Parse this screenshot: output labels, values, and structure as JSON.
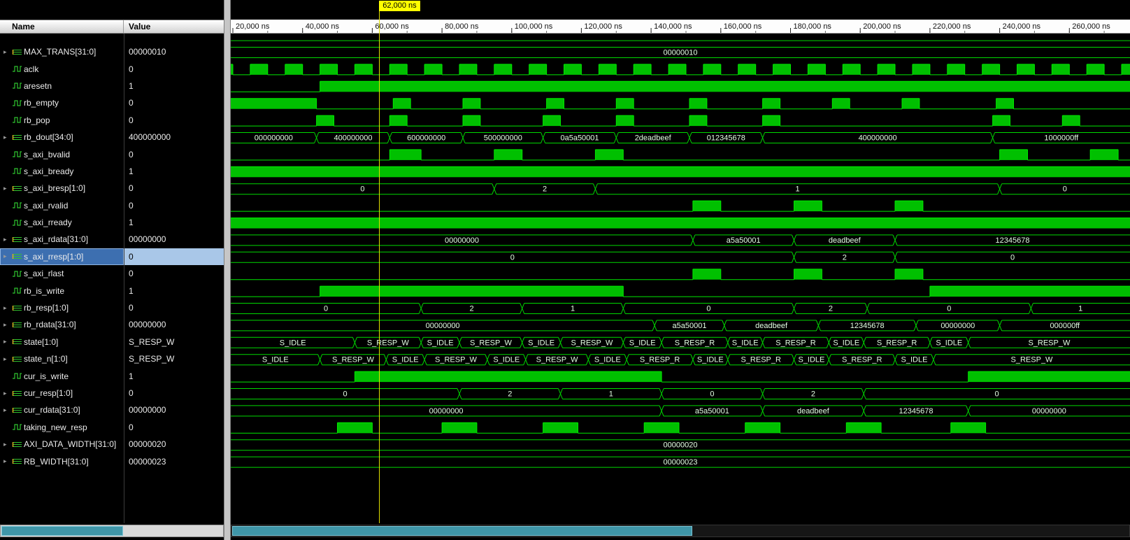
{
  "header": {
    "name_col": "Name",
    "value_col": "Value"
  },
  "cursor": {
    "time_ns": 62000,
    "label": "62,000 ns"
  },
  "icons": {
    "expander_glyph": "▸"
  },
  "colors": {
    "wave_fill": "#00c000",
    "wave_stroke": "#00e800",
    "bus_stroke": "#00d800",
    "bus_text": "#e4ffe4",
    "cursor_line": "#dede00",
    "cursor_flag_bg": "#ffff00",
    "selected_name_bg": "#3d6fb0",
    "selected_value_bg": "#a9c7e8",
    "scrollbar_thumb": "#3f96a8",
    "ruler_bg": "#fdfdfd"
  },
  "timeline": {
    "t_min": 19400,
    "t_max": 277400,
    "unit": "ns",
    "minor_step": 10000,
    "major_ticks": [
      {
        "t": 20000,
        "label": "20,000 ns"
      },
      {
        "t": 40000,
        "label": "40,000 ns"
      },
      {
        "t": 60000,
        "label": "60,000 ns"
      },
      {
        "t": 80000,
        "label": "80,000 ns"
      },
      {
        "t": 100000,
        "label": "100,000 ns"
      },
      {
        "t": 120000,
        "label": "120,000 ns"
      },
      {
        "t": 140000,
        "label": "140,000 ns"
      },
      {
        "t": 160000,
        "label": "160,000 ns"
      },
      {
        "t": 180000,
        "label": "180,000 ns"
      },
      {
        "t": 200000,
        "label": "200,000 ns"
      },
      {
        "t": 220000,
        "label": "220,000 ns"
      },
      {
        "t": 240000,
        "label": "240,000 ns"
      },
      {
        "t": 260000,
        "label": "260,000 ns"
      }
    ]
  },
  "signals": [
    {
      "partial": true,
      "name": "",
      "value": "",
      "kind": "bus",
      "icon": "bus",
      "expandable": false,
      "segments": [
        [
          19400,
          277400,
          ""
        ]
      ]
    },
    {
      "name": "MAX_TRANS[31:0]",
      "value": "00000010",
      "kind": "bus",
      "icon": "bus",
      "expandable": true,
      "segments": [
        [
          19400,
          277400,
          "00000010"
        ]
      ]
    },
    {
      "name": "aclk",
      "value": "0",
      "kind": "clock",
      "icon": "bit",
      "expandable": false,
      "period": 10000,
      "first_rise": 15000
    },
    {
      "name": "aresetn",
      "value": "1",
      "kind": "bit",
      "icon": "bit",
      "expandable": false,
      "segments": [
        [
          19400,
          45000,
          0
        ],
        [
          45000,
          277400,
          1
        ]
      ]
    },
    {
      "name": "rb_empty",
      "value": "0",
      "kind": "bit",
      "icon": "bit",
      "expandable": false,
      "segments": [
        [
          19400,
          44000,
          1
        ],
        [
          44000,
          66000,
          0
        ],
        [
          66000,
          71000,
          1
        ],
        [
          71000,
          86000,
          0
        ],
        [
          86000,
          91000,
          1
        ],
        [
          91000,
          110000,
          0
        ],
        [
          110000,
          115000,
          1
        ],
        [
          115000,
          130000,
          0
        ],
        [
          130000,
          135000,
          1
        ],
        [
          135000,
          151000,
          0
        ],
        [
          151000,
          156000,
          1
        ],
        [
          156000,
          172000,
          0
        ],
        [
          172000,
          177000,
          1
        ],
        [
          177000,
          192000,
          0
        ],
        [
          192000,
          197000,
          1
        ],
        [
          197000,
          212000,
          0
        ],
        [
          212000,
          217000,
          1
        ],
        [
          217000,
          239000,
          0
        ],
        [
          239000,
          244000,
          1
        ],
        [
          244000,
          277400,
          0
        ]
      ]
    },
    {
      "name": "rb_pop",
      "value": "0",
      "kind": "bit",
      "icon": "bit",
      "expandable": false,
      "segments": [
        [
          19400,
          44000,
          0
        ],
        [
          44000,
          49000,
          1
        ],
        [
          49000,
          65000,
          0
        ],
        [
          65000,
          70000,
          1
        ],
        [
          70000,
          86000,
          0
        ],
        [
          86000,
          91000,
          1
        ],
        [
          91000,
          109000,
          0
        ],
        [
          109000,
          114000,
          1
        ],
        [
          114000,
          130000,
          0
        ],
        [
          130000,
          135000,
          1
        ],
        [
          135000,
          151000,
          0
        ],
        [
          151000,
          156000,
          1
        ],
        [
          156000,
          172000,
          0
        ],
        [
          172000,
          177000,
          1
        ],
        [
          177000,
          238000,
          0
        ],
        [
          238000,
          243000,
          1
        ],
        [
          243000,
          258000,
          0
        ],
        [
          258000,
          263000,
          1
        ],
        [
          263000,
          277400,
          0
        ]
      ]
    },
    {
      "name": "rb_dout[34:0]",
      "value": "400000000",
      "kind": "bus",
      "icon": "bus",
      "expandable": true,
      "segments": [
        [
          19400,
          44000,
          "000000000"
        ],
        [
          44000,
          65000,
          "400000000"
        ],
        [
          65000,
          86000,
          "600000000"
        ],
        [
          86000,
          109000,
          "500000000"
        ],
        [
          109000,
          130000,
          "0a5a50001"
        ],
        [
          130000,
          151000,
          "2deadbeef"
        ],
        [
          151000,
          172000,
          "012345678"
        ],
        [
          172000,
          238000,
          "400000000"
        ],
        [
          238000,
          277400,
          "1000000ff"
        ]
      ]
    },
    {
      "name": "s_axi_bvalid",
      "value": "0",
      "kind": "bit",
      "icon": "bit",
      "expandable": false,
      "segments": [
        [
          19400,
          65000,
          0
        ],
        [
          65000,
          74000,
          1
        ],
        [
          74000,
          95000,
          0
        ],
        [
          95000,
          103000,
          1
        ],
        [
          103000,
          124000,
          0
        ],
        [
          124000,
          132000,
          1
        ],
        [
          132000,
          240000,
          0
        ],
        [
          240000,
          248000,
          1
        ],
        [
          248000,
          266000,
          0
        ],
        [
          266000,
          274000,
          1
        ],
        [
          274000,
          277400,
          0
        ]
      ]
    },
    {
      "name": "s_axi_bready",
      "value": "1",
      "kind": "bit",
      "icon": "bit",
      "expandable": false,
      "segments": [
        [
          19400,
          277400,
          1
        ]
      ]
    },
    {
      "name": "s_axi_bresp[1:0]",
      "value": "0",
      "kind": "bus",
      "icon": "bus",
      "expandable": true,
      "segments": [
        [
          19400,
          95000,
          "0"
        ],
        [
          95000,
          124000,
          "2"
        ],
        [
          124000,
          240000,
          "1"
        ],
        [
          240000,
          277400,
          "0"
        ]
      ]
    },
    {
      "name": "s_axi_rvalid",
      "value": "0",
      "kind": "bit",
      "icon": "bit",
      "expandable": false,
      "segments": [
        [
          19400,
          152000,
          0
        ],
        [
          152000,
          160000,
          1
        ],
        [
          160000,
          181000,
          0
        ],
        [
          181000,
          189000,
          1
        ],
        [
          189000,
          210000,
          0
        ],
        [
          210000,
          218000,
          1
        ],
        [
          218000,
          277400,
          0
        ]
      ]
    },
    {
      "name": "s_axi_rready",
      "value": "1",
      "kind": "bit",
      "icon": "bit",
      "expandable": false,
      "segments": [
        [
          19400,
          277400,
          1
        ]
      ]
    },
    {
      "name": "s_axi_rdata[31:0]",
      "value": "00000000",
      "kind": "bus",
      "icon": "bus",
      "expandable": true,
      "segments": [
        [
          19400,
          152000,
          "00000000"
        ],
        [
          152000,
          181000,
          "a5a50001"
        ],
        [
          181000,
          210000,
          "deadbeef"
        ],
        [
          210000,
          277400,
          "12345678"
        ]
      ]
    },
    {
      "name": "s_axi_rresp[1:0]",
      "value": "0",
      "kind": "bus",
      "icon": "bus",
      "expandable": true,
      "selected": true,
      "segments": [
        [
          19400,
          181000,
          "0"
        ],
        [
          181000,
          210000,
          "2"
        ],
        [
          210000,
          277400,
          "0"
        ]
      ]
    },
    {
      "name": "s_axi_rlast",
      "value": "0",
      "kind": "bit",
      "icon": "bit",
      "expandable": false,
      "segments": [
        [
          19400,
          152000,
          0
        ],
        [
          152000,
          160000,
          1
        ],
        [
          160000,
          181000,
          0
        ],
        [
          181000,
          189000,
          1
        ],
        [
          189000,
          210000,
          0
        ],
        [
          210000,
          218000,
          1
        ],
        [
          218000,
          277400,
          0
        ]
      ]
    },
    {
      "name": "rb_is_write",
      "value": "1",
      "kind": "bit",
      "icon": "bit",
      "expandable": false,
      "segments": [
        [
          19400,
          45000,
          0
        ],
        [
          45000,
          132000,
          1
        ],
        [
          132000,
          220000,
          0
        ],
        [
          220000,
          277400,
          1
        ]
      ]
    },
    {
      "name": "rb_resp[1:0]",
      "value": "0",
      "kind": "bus",
      "icon": "bus",
      "expandable": true,
      "segments": [
        [
          19400,
          74000,
          "0"
        ],
        [
          74000,
          103000,
          "2"
        ],
        [
          103000,
          132000,
          "1"
        ],
        [
          132000,
          181000,
          "0"
        ],
        [
          181000,
          202000,
          "2"
        ],
        [
          202000,
          249000,
          "0"
        ],
        [
          249000,
          277400,
          "1"
        ]
      ]
    },
    {
      "name": "rb_rdata[31:0]",
      "value": "00000000",
      "kind": "bus",
      "icon": "bus",
      "expandable": true,
      "segments": [
        [
          19400,
          141000,
          "00000000"
        ],
        [
          141000,
          161000,
          "a5a50001"
        ],
        [
          161000,
          188000,
          "deadbeef"
        ],
        [
          188000,
          216000,
          "12345678"
        ],
        [
          216000,
          240000,
          "00000000"
        ],
        [
          240000,
          277400,
          "000000ff"
        ]
      ]
    },
    {
      "name": "state[1:0]",
      "value": "S_RESP_W",
      "kind": "bus",
      "icon": "bus",
      "expandable": true,
      "segments": [
        [
          19400,
          55000,
          "S_IDLE"
        ],
        [
          55000,
          74000,
          "S_RESP_W"
        ],
        [
          74000,
          85000,
          "S_IDLE"
        ],
        [
          85000,
          103000,
          "S_RESP_W"
        ],
        [
          103000,
          114000,
          "S_IDLE"
        ],
        [
          114000,
          132000,
          "S_RESP_W"
        ],
        [
          132000,
          143000,
          "S_IDLE"
        ],
        [
          143000,
          162000,
          "S_RESP_R"
        ],
        [
          162000,
          172000,
          "S_IDLE"
        ],
        [
          172000,
          191000,
          "S_RESP_R"
        ],
        [
          191000,
          201000,
          "S_IDLE"
        ],
        [
          201000,
          220000,
          "S_RESP_R"
        ],
        [
          220000,
          231000,
          "S_IDLE"
        ],
        [
          231000,
          277400,
          "S_RESP_W"
        ]
      ]
    },
    {
      "name": "state_n[1:0]",
      "value": "S_RESP_W",
      "kind": "bus",
      "icon": "bus",
      "expandable": true,
      "segments": [
        [
          19400,
          45000,
          "S_IDLE"
        ],
        [
          45000,
          64000,
          "S_RESP_W"
        ],
        [
          64000,
          75000,
          "S_IDLE"
        ],
        [
          75000,
          93000,
          "S_RESP_W"
        ],
        [
          93000,
          104000,
          "S_IDLE"
        ],
        [
          104000,
          122000,
          "S_RESP_W"
        ],
        [
          122000,
          133000,
          "S_IDLE"
        ],
        [
          133000,
          152000,
          "S_RESP_R"
        ],
        [
          152000,
          162000,
          "S_IDLE"
        ],
        [
          162000,
          181000,
          "S_RESP_R"
        ],
        [
          181000,
          191000,
          "S_IDLE"
        ],
        [
          191000,
          210000,
          "S_RESP_R"
        ],
        [
          210000,
          221000,
          "S_IDLE"
        ],
        [
          221000,
          277400,
          "S_RESP_W"
        ]
      ]
    },
    {
      "name": "cur_is_write",
      "value": "1",
      "kind": "bit",
      "icon": "bit",
      "expandable": false,
      "segments": [
        [
          19400,
          55000,
          0
        ],
        [
          55000,
          143000,
          1
        ],
        [
          143000,
          231000,
          0
        ],
        [
          231000,
          277400,
          1
        ]
      ]
    },
    {
      "name": "cur_resp[1:0]",
      "value": "0",
      "kind": "bus",
      "icon": "bus",
      "expandable": true,
      "segments": [
        [
          19400,
          85000,
          "0"
        ],
        [
          85000,
          114000,
          "2"
        ],
        [
          114000,
          143000,
          "1"
        ],
        [
          143000,
          172000,
          "0"
        ],
        [
          172000,
          201000,
          "2"
        ],
        [
          201000,
          277400,
          "0"
        ]
      ]
    },
    {
      "name": "cur_rdata[31:0]",
      "value": "00000000",
      "kind": "bus",
      "icon": "bus",
      "expandable": true,
      "segments": [
        [
          19400,
          143000,
          "00000000"
        ],
        [
          143000,
          172000,
          "a5a50001"
        ],
        [
          172000,
          201000,
          "deadbeef"
        ],
        [
          201000,
          231000,
          "12345678"
        ],
        [
          231000,
          277400,
          "00000000"
        ]
      ]
    },
    {
      "name": "taking_new_resp",
      "value": "0",
      "kind": "bit",
      "icon": "bit",
      "expandable": false,
      "segments": [
        [
          19400,
          50000,
          0
        ],
        [
          50000,
          60000,
          1
        ],
        [
          60000,
          80000,
          0
        ],
        [
          80000,
          90000,
          1
        ],
        [
          90000,
          109000,
          0
        ],
        [
          109000,
          119000,
          1
        ],
        [
          119000,
          138000,
          0
        ],
        [
          138000,
          148000,
          1
        ],
        [
          148000,
          167000,
          0
        ],
        [
          167000,
          177000,
          1
        ],
        [
          177000,
          196000,
          0
        ],
        [
          196000,
          206000,
          1
        ],
        [
          206000,
          226000,
          0
        ],
        [
          226000,
          236000,
          1
        ],
        [
          236000,
          277400,
          0
        ]
      ]
    },
    {
      "name": "AXI_DATA_WIDTH[31:0]",
      "value": "00000020",
      "kind": "bus",
      "icon": "bus",
      "expandable": true,
      "segments": [
        [
          19400,
          277400,
          "00000020"
        ]
      ]
    },
    {
      "name": "RB_WIDTH[31:0]",
      "value": "00000023",
      "kind": "bus",
      "icon": "bus",
      "expandable": true,
      "segments": [
        [
          19400,
          277400,
          "00000023"
        ]
      ]
    }
  ]
}
